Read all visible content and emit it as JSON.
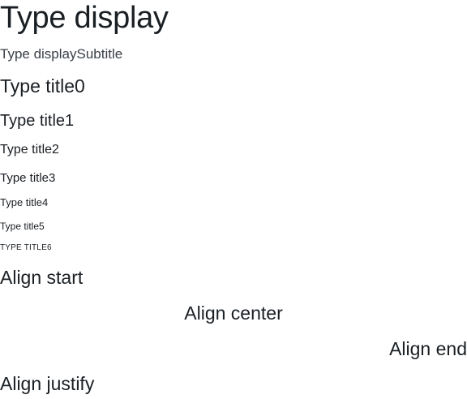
{
  "typography": {
    "display": "Type display",
    "display_subtitle": "Type displaySubtitle",
    "title0": "Type title0",
    "title1": "Type title1",
    "title2": "Type title2",
    "title3": "Type title3",
    "title4": "Type title4",
    "title5": "Type title5",
    "title6": "Type title6"
  },
  "alignment": {
    "start": "Align start",
    "center": "Align center",
    "end": "Align end",
    "justify": "Align justify"
  },
  "colors": {
    "text": "#1a1f24",
    "subtitle": "#3a4048",
    "background": "#ffffff"
  }
}
